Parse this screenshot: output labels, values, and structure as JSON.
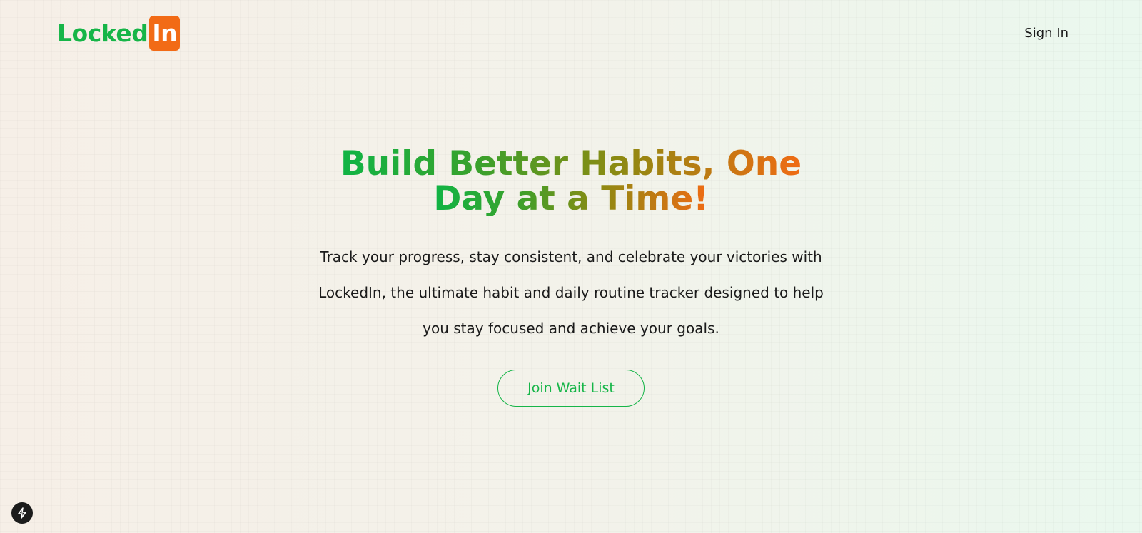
{
  "header": {
    "logo_main": "Locked",
    "logo_box": "In",
    "sign_in_label": "Sign In"
  },
  "hero": {
    "title_line1": "Build Better Habits, One",
    "title_line2": "Day at a Time!",
    "subtitle": "Track your progress, stay consistent, and celebrate your victories with LockedIn, the ultimate habit and daily routine tracker designed to help you stay focused and achieve your goals.",
    "cta_label": "Join Wait List"
  },
  "floating": {
    "icon": "bolt-icon"
  },
  "colors": {
    "brand_green": "#16b548",
    "brand_orange": "#f26b16",
    "text_dark": "#1a1a1a"
  }
}
